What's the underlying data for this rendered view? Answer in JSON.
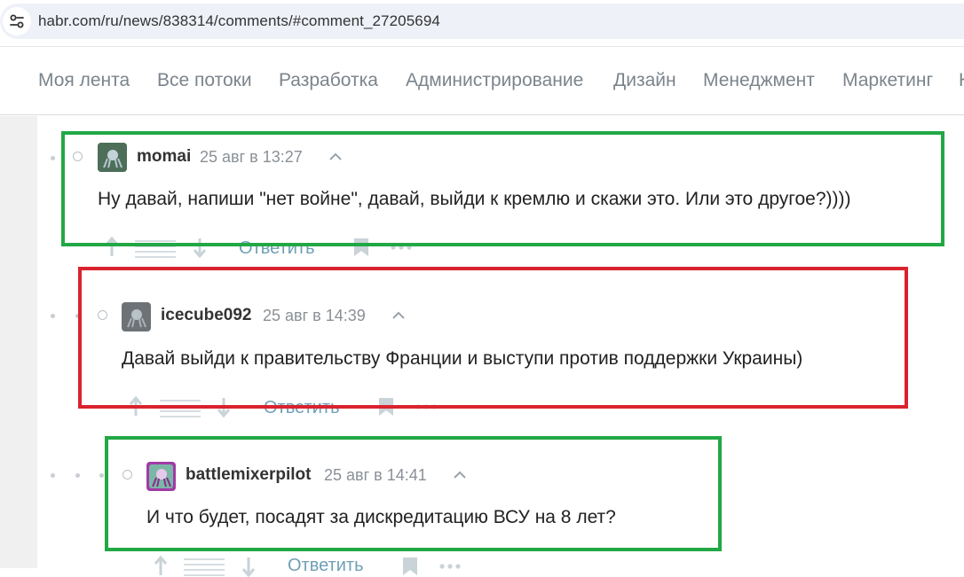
{
  "address_bar": {
    "url": "habr.com/ru/news/838314/comments/#comment_27205694",
    "site_info_icon": "tune-icon"
  },
  "nav": {
    "items": [
      {
        "label": "Моя лента"
      },
      {
        "label": "Все потоки"
      },
      {
        "label": "Разработка"
      },
      {
        "label": "Администрирование"
      },
      {
        "label": "Дизайн"
      },
      {
        "label": "Менеджмент"
      },
      {
        "label": "Маркетинг"
      },
      {
        "label": "К"
      }
    ]
  },
  "comments": [
    {
      "username": "momai",
      "timestamp": "25 авг в 13:27",
      "text": "Ну давай, напиши \"нет войне\", давай, выйди к кремлю и скажи это. Или это другое?))))",
      "reply_label": "Ответить",
      "highlight": "#21a844"
    },
    {
      "username": "icecube092",
      "timestamp": "25 авг в 14:39",
      "text": "Давай выйди к правительству Франции и выступи против поддержки Украины)",
      "reply_label": "Ответить",
      "highlight": "#d9232e"
    },
    {
      "username": "battlemixerpilot",
      "timestamp": "25 авг в 14:41",
      "text": "И что будет, посадят за дискредитацию ВСУ на 8 лет?",
      "reply_label": "Ответить",
      "highlight": "#21a844"
    }
  ],
  "colors": {
    "nav_text": "#7b848c",
    "reply_link": "#6f9fb5",
    "highlight_green": "#21a844",
    "highlight_red": "#d9232e"
  }
}
